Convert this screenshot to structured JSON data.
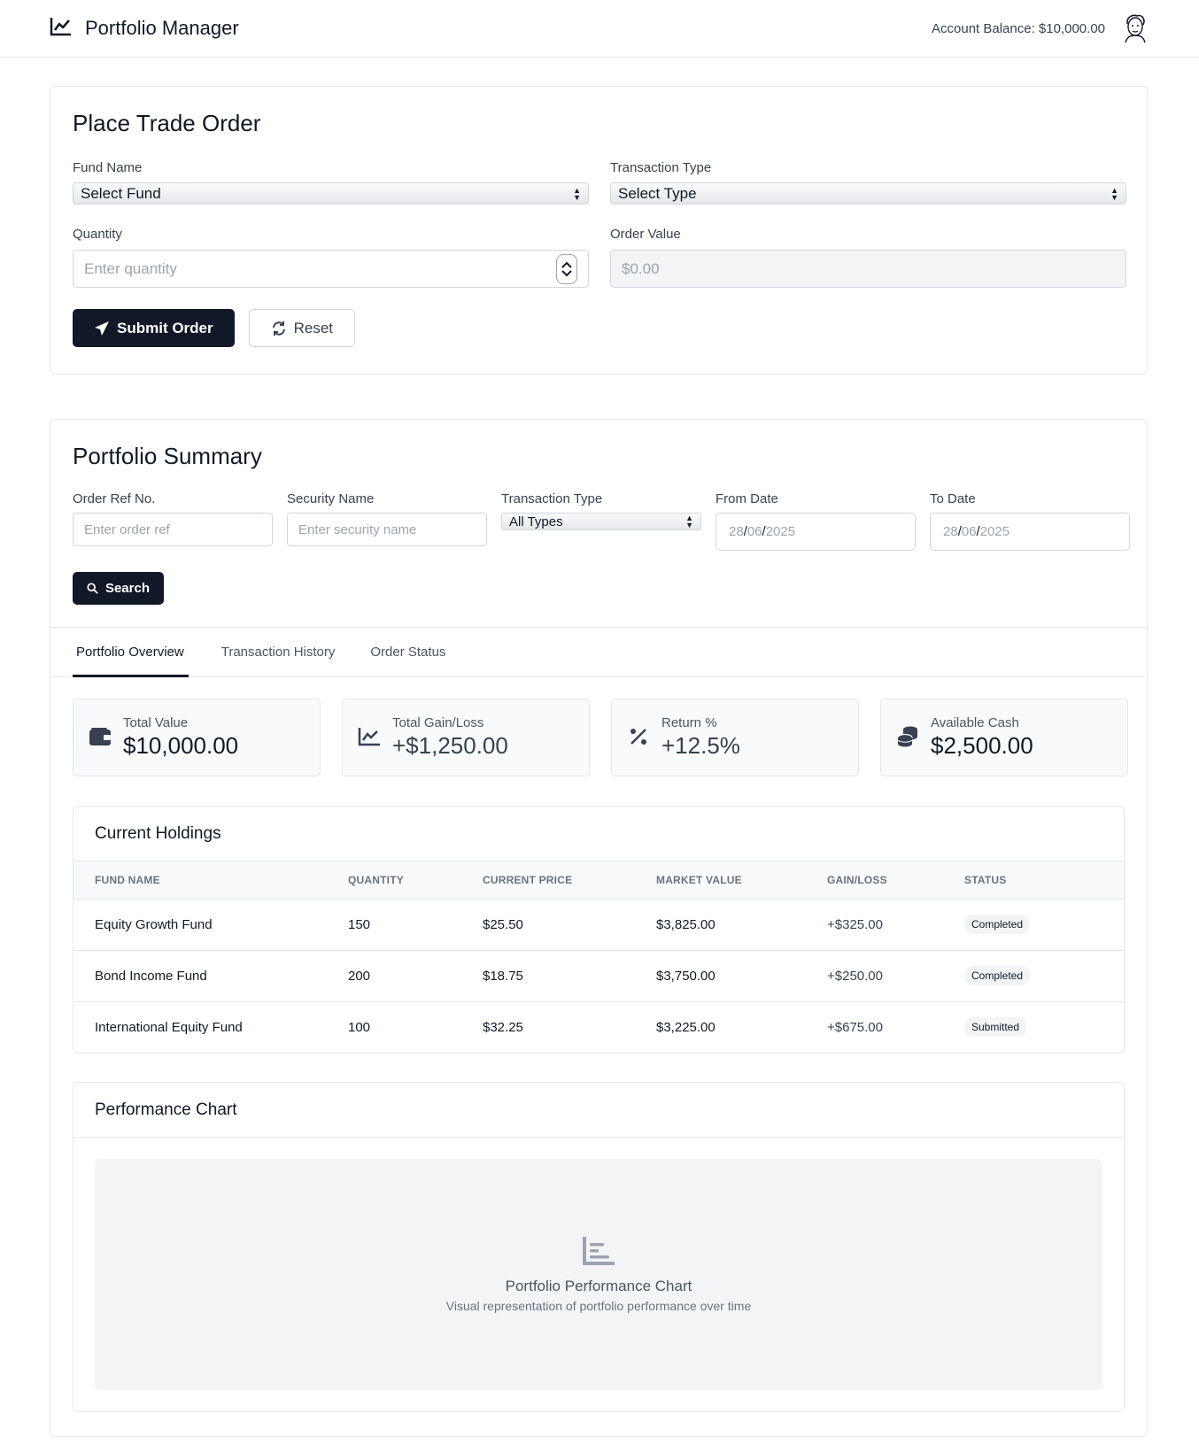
{
  "header": {
    "app_title": "Portfolio Manager",
    "account_balance": "Account Balance: $10,000.00",
    "brand_icon": "line-chart-icon",
    "avatar_icon": "user-avatar"
  },
  "trade": {
    "title": "Place Trade Order",
    "fund_label": "Fund Name",
    "fund_value": "Select Fund",
    "type_label": "Transaction Type",
    "type_value": "Select Type",
    "qty_label": "Quantity",
    "qty_placeholder": "Enter quantity",
    "order_value_label": "Order Value",
    "order_value": "$0.00",
    "submit_label": "Submit Order",
    "reset_label": "Reset"
  },
  "summary": {
    "title": "Portfolio Summary",
    "filters": {
      "order_ref_label": "Order Ref No.",
      "order_ref_placeholder": "Enter order ref",
      "security_label": "Security Name",
      "security_placeholder": "Enter security name",
      "type_label": "Transaction Type",
      "type_value": "All Types",
      "from_label": "From Date",
      "from_day": "28",
      "from_month": "06",
      "from_year": "2025",
      "to_label": "To Date",
      "to_day": "28",
      "to_month": "06",
      "to_year": "2025",
      "date_sep": "/"
    },
    "search_label": "Search",
    "tabs": [
      "Portfolio Overview",
      "Transaction History",
      "Order Status"
    ],
    "stats": [
      {
        "label": "Total Value",
        "value": "$10,000.00",
        "icon": "wallet-icon"
      },
      {
        "label": "Total Gain/Loss",
        "value": "+$1,250.00",
        "icon": "chart-line-icon"
      },
      {
        "label": "Return %",
        "value": "+12.5%",
        "icon": "percent-icon"
      },
      {
        "label": "Available Cash",
        "value": "$2,500.00",
        "icon": "coins-icon"
      }
    ]
  },
  "holdings": {
    "title": "Current Holdings",
    "columns": [
      "FUND NAME",
      "QUANTITY",
      "CURRENT PRICE",
      "MARKET VALUE",
      "GAIN/LOSS",
      "STATUS"
    ],
    "rows": [
      [
        "Equity Growth Fund",
        "150",
        "$25.50",
        "$3,825.00",
        "+$325.00",
        "Completed"
      ],
      [
        "Bond Income Fund",
        "200",
        "$18.75",
        "$3,750.00",
        "+$250.00",
        "Completed"
      ],
      [
        "International Equity Fund",
        "100",
        "$32.25",
        "$3,225.00",
        "+$675.00",
        "Submitted"
      ]
    ]
  },
  "performance": {
    "title": "Performance Chart",
    "placeholder_title": "Portfolio Performance Chart",
    "placeholder_sub": "Visual representation of portfolio performance over time",
    "icon": "bar-chart-icon"
  }
}
